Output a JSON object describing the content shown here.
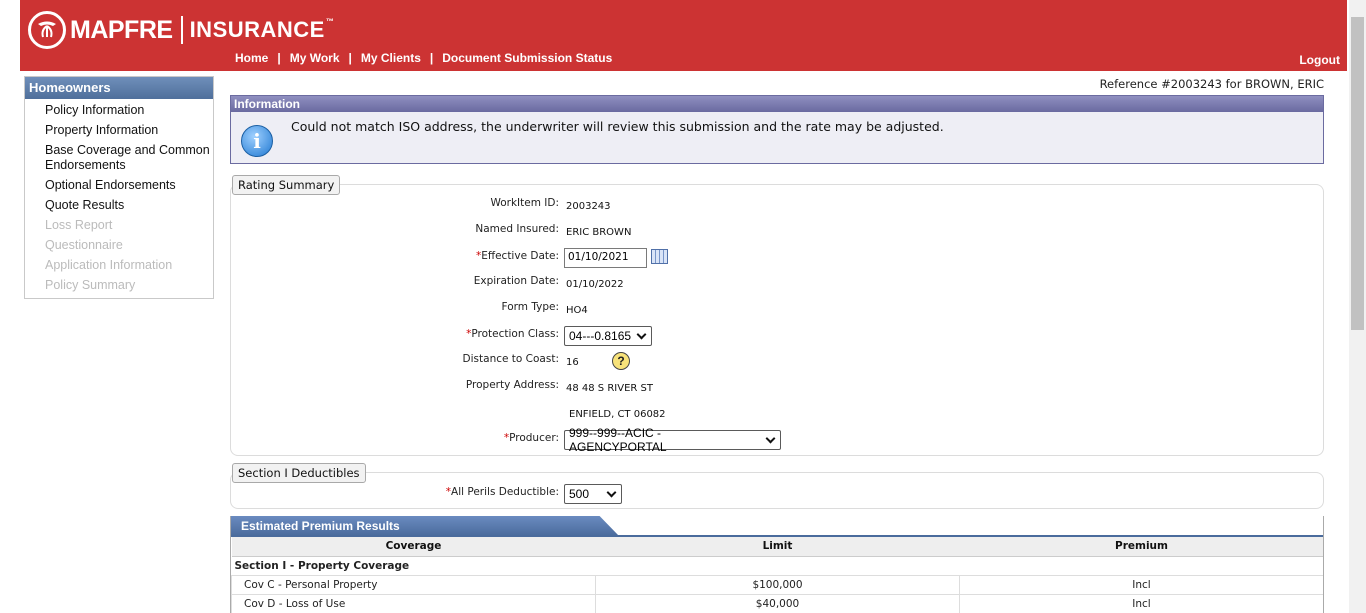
{
  "brand": {
    "name": "MAPFRE",
    "product": "INSURANCE",
    "tm": "™"
  },
  "nav": {
    "items": [
      "Home",
      "My Work",
      "My Clients",
      "Document Submission Status"
    ],
    "separator": "|",
    "logout": "Logout"
  },
  "reference": "Reference #2003243 for BROWN, ERIC",
  "sidebar": {
    "title": "Homeowners",
    "items": [
      {
        "label": "Policy Information",
        "enabled": true
      },
      {
        "label": "Property Information",
        "enabled": true
      },
      {
        "label": "Base Coverage and Common Endorsements",
        "enabled": true
      },
      {
        "label": "Optional Endorsements",
        "enabled": true
      },
      {
        "label": "Quote Results",
        "enabled": true
      },
      {
        "label": "Loss Report",
        "enabled": false
      },
      {
        "label": "Questionnaire",
        "enabled": false
      },
      {
        "label": "Application Information",
        "enabled": false
      },
      {
        "label": "Policy Summary",
        "enabled": false
      }
    ]
  },
  "info": {
    "title": "Information",
    "message": "Could not match ISO address, the underwriter will review this submission and the rate may be adjusted."
  },
  "rating": {
    "legend": "Rating Summary",
    "required_mark": "*",
    "workitem_label": "WorkItem ID:",
    "workitem": "2003243",
    "insured_label": "Named Insured:",
    "insured": "ERIC BROWN",
    "effective_label": "Effective Date:",
    "effective": "01/10/2021",
    "expiration_label": "Expiration Date:",
    "expiration": "01/10/2022",
    "form_label": "Form Type:",
    "form": "HO4",
    "protection_label": "Protection Class:",
    "protection": "04---0.8165",
    "coast_label": "Distance to Coast:",
    "coast": "16",
    "address_label": "Property Address:",
    "address1": "48 48 S RIVER ST",
    "address2": "ENFIELD, CT 06082",
    "producer_label": "Producer:",
    "producer": "999--999--ACIC - AGENCYPORTAL"
  },
  "deductibles": {
    "legend": "Section I Deductibles",
    "perils_label": "All Perils Deductible:",
    "perils": "500"
  },
  "premium": {
    "title": "Estimated Premium Results",
    "columns": [
      "Coverage",
      "Limit",
      "Premium"
    ],
    "section": "Section I - Property Coverage",
    "rows": [
      {
        "coverage": "Cov C - Personal Property",
        "limit": "$100,000",
        "premium": "Incl"
      },
      {
        "coverage": "Cov D - Loss of Use",
        "limit": "$40,000",
        "premium": "Incl"
      }
    ]
  },
  "colors": {
    "header": "#cc3333",
    "sidebar_head": "#5a7aa8",
    "info_head": "#7a7ab0",
    "premium_tab": "#5577aa"
  },
  "icons": {
    "info": "info-circle-icon",
    "calendar": "calendar-icon",
    "help": "question-mark-icon",
    "logo": "mapfre-logo-icon"
  }
}
